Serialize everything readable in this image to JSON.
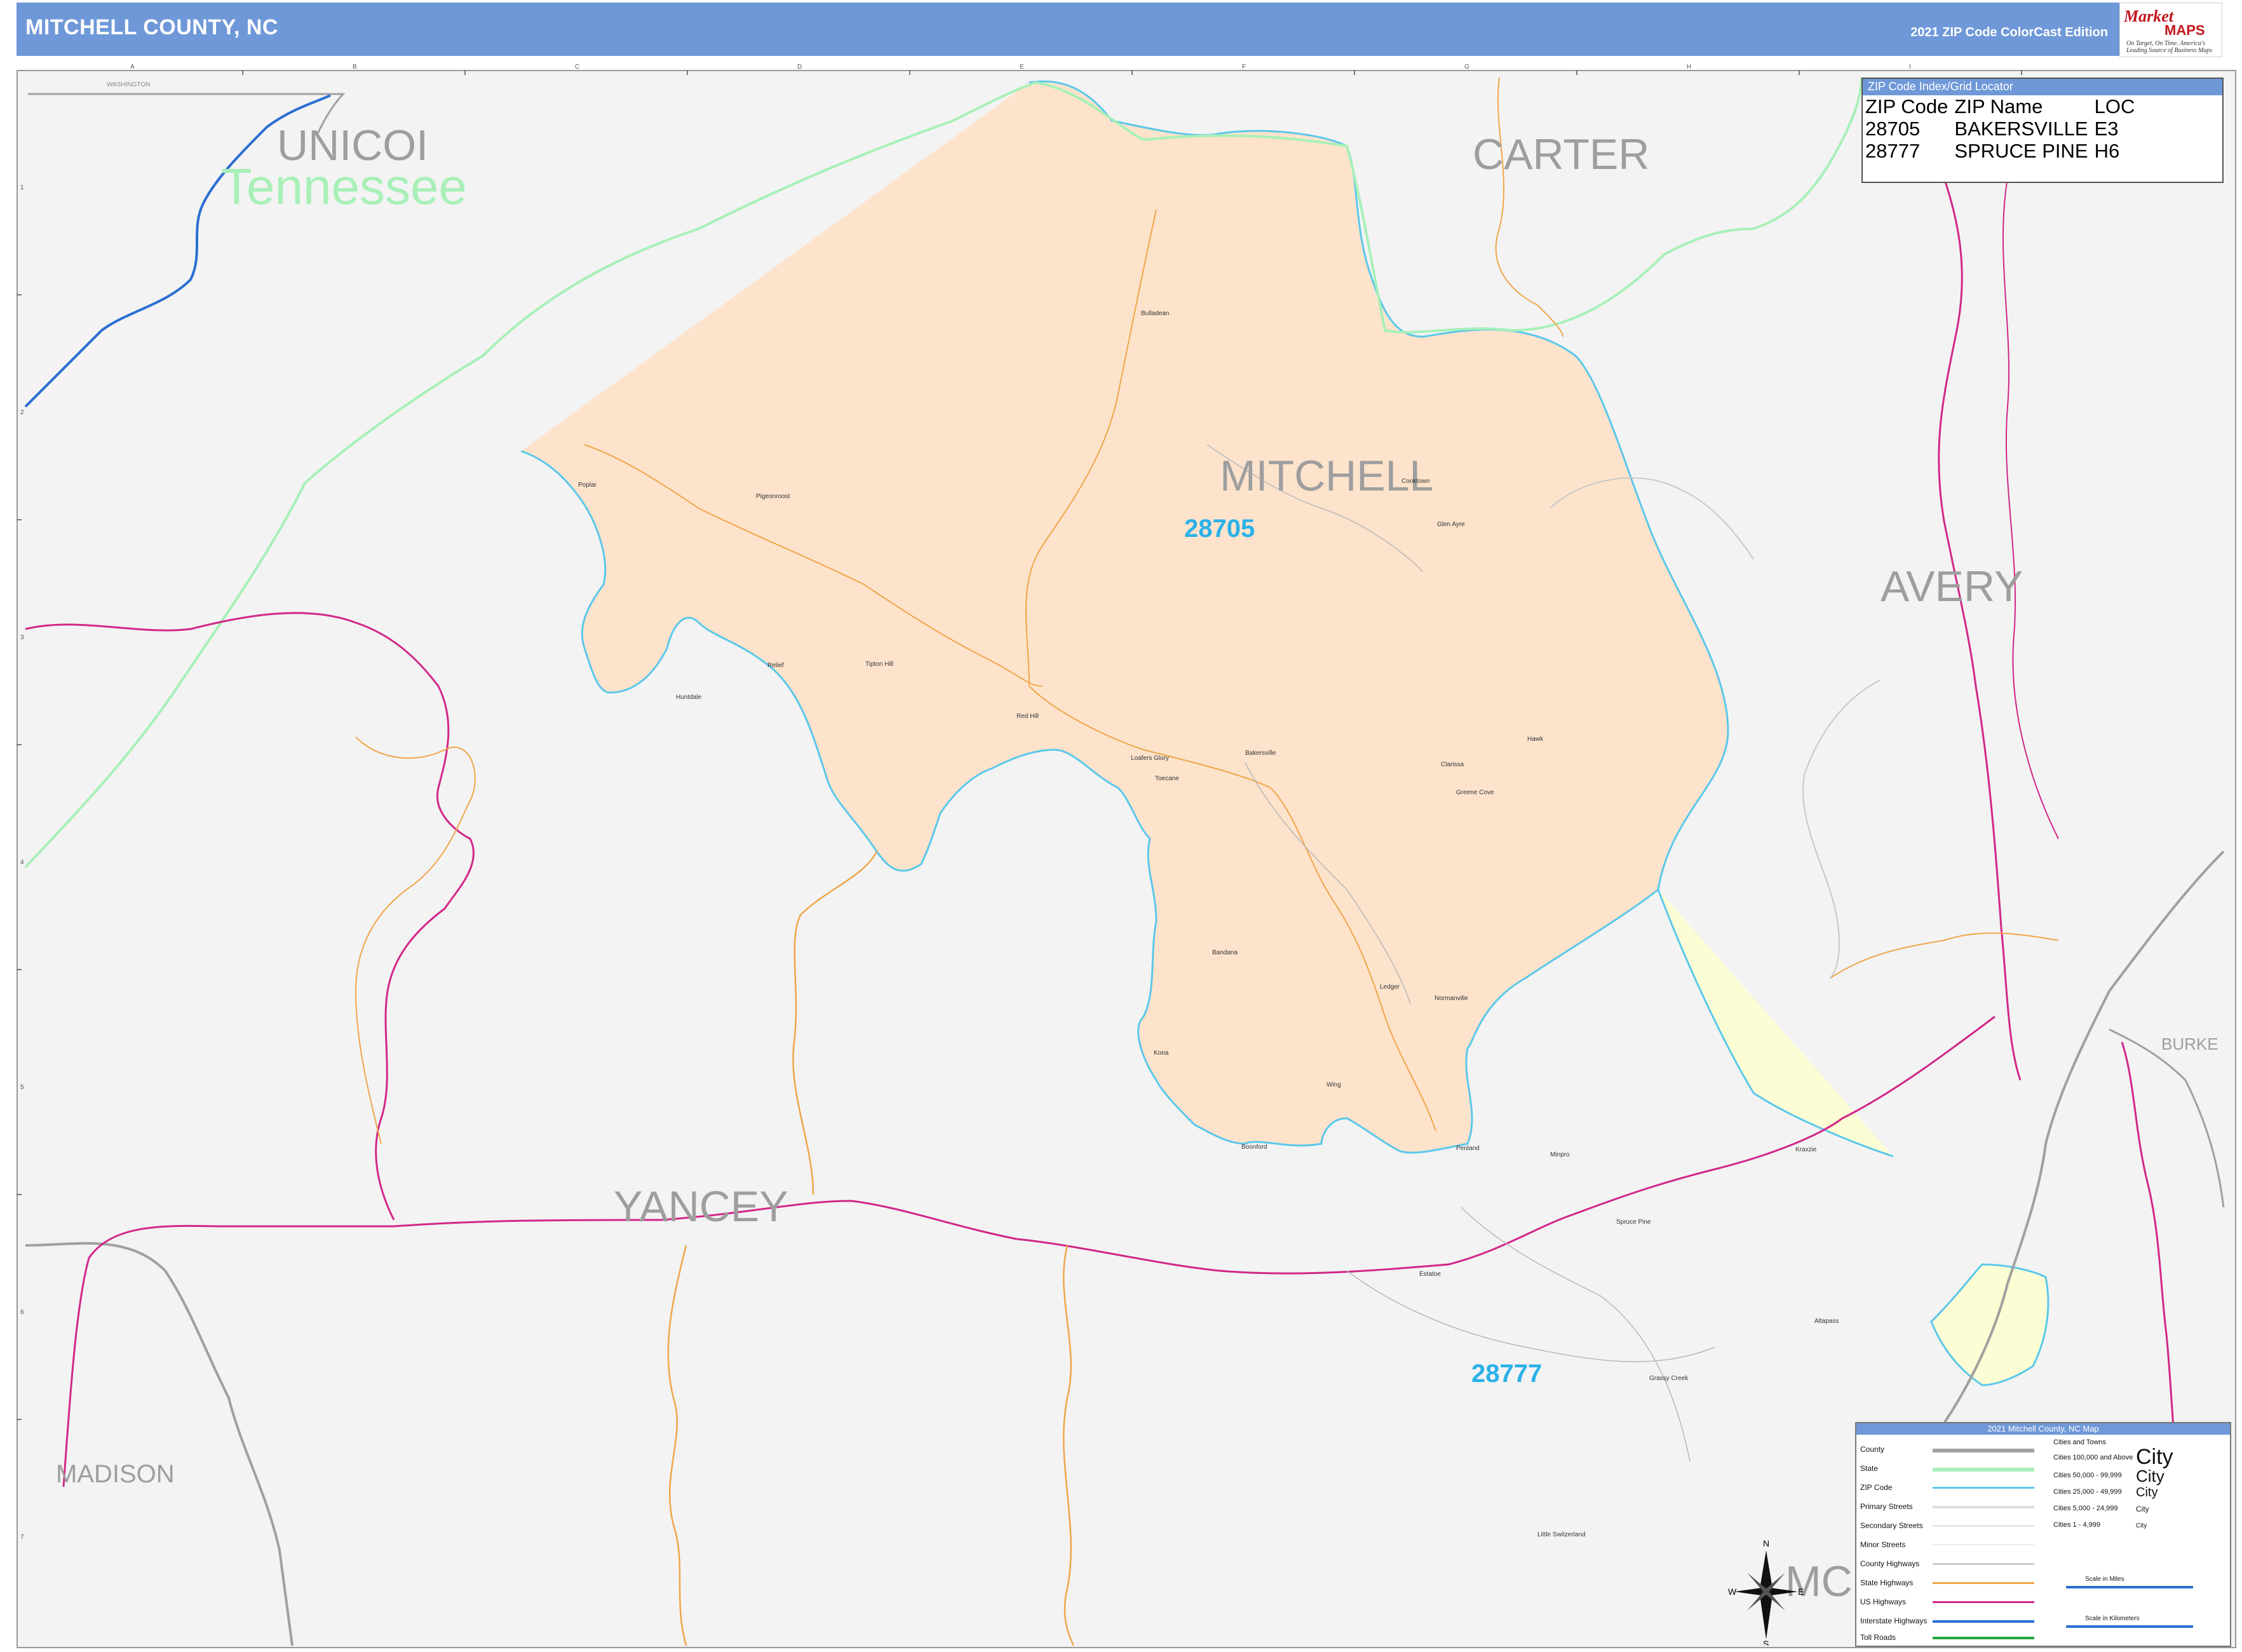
{
  "header": {
    "title": "MITCHELL COUNTY, NC",
    "edition": "2021 ZIP Code ColorCast Edition",
    "brand_name": "Market",
    "brand_maps": "MAPS",
    "brand_tagline": "On Target, On Time. America's Leading Source of Business Maps"
  },
  "map": {
    "counties": {
      "unicoi": "UNICOI",
      "carter": "CARTER",
      "mitchell": "MITCHELL",
      "avery": "AVERY",
      "yancey": "YANCEY",
      "madison": "MADISON",
      "burke": "BURKE",
      "mc_partial": "MC"
    },
    "state_label": "Tennessee",
    "zip_labels": {
      "z28705": "28705",
      "z28777": "28777"
    },
    "zip_colors": {
      "28705": "#fde3cc",
      "28777": "#fdfdd5"
    },
    "washington_label": "WASHINGTON",
    "towns": [
      {
        "name": "Bulladean",
        "id": "bulladean"
      },
      {
        "name": "Poplar",
        "id": "poplar"
      },
      {
        "name": "Pigeonroost",
        "id": "pigeonroost"
      },
      {
        "name": "Cooktown",
        "id": "cooktown"
      },
      {
        "name": "Glen Ayre",
        "id": "glen-ayre"
      },
      {
        "name": "Relief",
        "id": "relief"
      },
      {
        "name": "Tipton Hill",
        "id": "tipton-hill"
      },
      {
        "name": "Huntdale",
        "id": "huntdale"
      },
      {
        "name": "Red Hill",
        "id": "red-hill"
      },
      {
        "name": "Loafers Glory",
        "id": "loafers-glory"
      },
      {
        "name": "Bakersville",
        "id": "bakersville"
      },
      {
        "name": "Toecane",
        "id": "toecane"
      },
      {
        "name": "Hawk",
        "id": "hawk"
      },
      {
        "name": "Clarissa",
        "id": "clarissa"
      },
      {
        "name": "Greene Cove",
        "id": "greene-cove"
      },
      {
        "name": "Bandana",
        "id": "bandana"
      },
      {
        "name": "Ledger",
        "id": "ledger"
      },
      {
        "name": "Normanville",
        "id": "normanville"
      },
      {
        "name": "Kona",
        "id": "kona"
      },
      {
        "name": "Wing",
        "id": "wing"
      },
      {
        "name": "Boonford",
        "id": "boonford"
      },
      {
        "name": "Penland",
        "id": "penland"
      },
      {
        "name": "Minpro",
        "id": "minpro"
      },
      {
        "name": "Spruce Pine",
        "id": "spruce-pine"
      },
      {
        "name": "Kraxzie",
        "id": "kraxzie"
      },
      {
        "name": "Estatoe",
        "id": "estatoe"
      },
      {
        "name": "Altapass",
        "id": "altapass"
      },
      {
        "name": "Grassy Creek",
        "id": "grassy-creek"
      },
      {
        "name": "Little Switzerland",
        "id": "little-switzerland"
      }
    ],
    "grid_columns": [
      "A",
      "B",
      "C",
      "D",
      "E",
      "F",
      "G",
      "H",
      "I"
    ],
    "grid_rows": [
      "1",
      "2",
      "3",
      "4",
      "5",
      "6",
      "7"
    ]
  },
  "index": {
    "title": "ZIP Code Index/Grid Locator",
    "headers": [
      "ZIP Code",
      "ZIP Name",
      "LOC"
    ],
    "rows": [
      [
        "28705",
        "BAKERSVILLE",
        "E3"
      ],
      [
        "28777",
        "SPRUCE PINE",
        "H6"
      ]
    ]
  },
  "legend": {
    "title": "2021 Mitchell County, NC Map",
    "items": [
      {
        "label": "County",
        "color": "#a0a0a0"
      },
      {
        "label": "State",
        "color": "#a8f0b8"
      },
      {
        "label": "ZIP Code",
        "color": "#5bc8ea"
      },
      {
        "label": "Primary Streets",
        "color": "#dddddd"
      },
      {
        "label": "Secondary Streets",
        "color": "#e6e6e6"
      },
      {
        "label": "Minor Streets",
        "color": "#eeeeee"
      },
      {
        "label": "County Highways",
        "color": "#cccccc"
      },
      {
        "label": "State Highways",
        "color": "#f0a64a"
      },
      {
        "label": "US Highways",
        "color": "#d1278a"
      },
      {
        "label": "Interstate Highways",
        "color": "#2b6fd1"
      },
      {
        "label": "Toll Roads",
        "color": "#23a83a"
      }
    ],
    "cities_heading": "Cities and Towns",
    "cities": [
      {
        "range": "Cities 100,000 and Above",
        "sample": "City"
      },
      {
        "range": "Cities 50,000 - 99,999",
        "sample": "City"
      },
      {
        "range": "Cities 25,000 - 49,999",
        "sample": "City"
      },
      {
        "range": "Cities 5,000 - 24,999",
        "sample": "City"
      },
      {
        "range": "Cities 1 - 4,999",
        "sample": "City"
      }
    ],
    "scale_miles": "Scale in Miles",
    "scale_km": "Scale in Kilometers"
  },
  "compass": {
    "n": "N",
    "s": "S",
    "e": "E",
    "w": "W"
  }
}
